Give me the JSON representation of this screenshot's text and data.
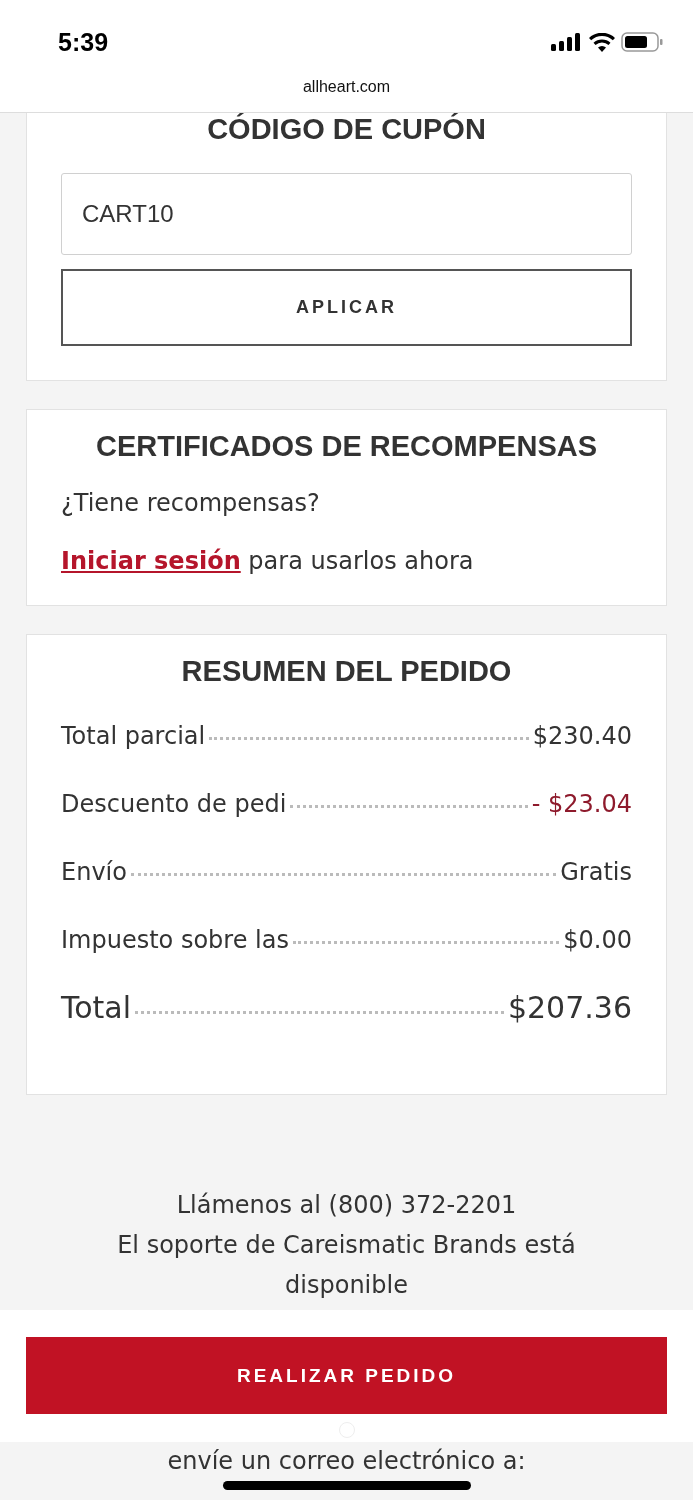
{
  "status_bar": {
    "time": "5:39"
  },
  "address_bar": {
    "url": "allheart.com"
  },
  "coupon": {
    "title": "CÓDIGO DE CUPÓN",
    "value": "CART10",
    "button": "APLICAR"
  },
  "rewards": {
    "title": "CERTIFICADOS DE RECOMPENSAS",
    "question": "¿Tiene recompensas?",
    "link": "Iniciar sesión",
    "text": "para usarlos ahora"
  },
  "summary": {
    "title": "RESUMEN DEL PEDIDO",
    "rows": [
      {
        "label": "Total parcial",
        "value": "$230.40",
        "kind": "normal"
      },
      {
        "label": "Descuento de pedi",
        "value": "- $23.04",
        "kind": "discount"
      },
      {
        "label": "Envío",
        "value": "Gratis",
        "kind": "normal"
      },
      {
        "label": "Impuesto sobre las",
        "value": "$0.00",
        "kind": "normal"
      },
      {
        "label": "Total",
        "value": "$207.36",
        "kind": "total"
      }
    ]
  },
  "support": {
    "lines": [
      "Llámenos al (800) 372-2201",
      "El soporte de Careismatic Brands está",
      "disponible"
    ],
    "email_line": "envíe un correo electrónico a:"
  },
  "place_order": {
    "label": "REALIZAR PEDIDO"
  }
}
